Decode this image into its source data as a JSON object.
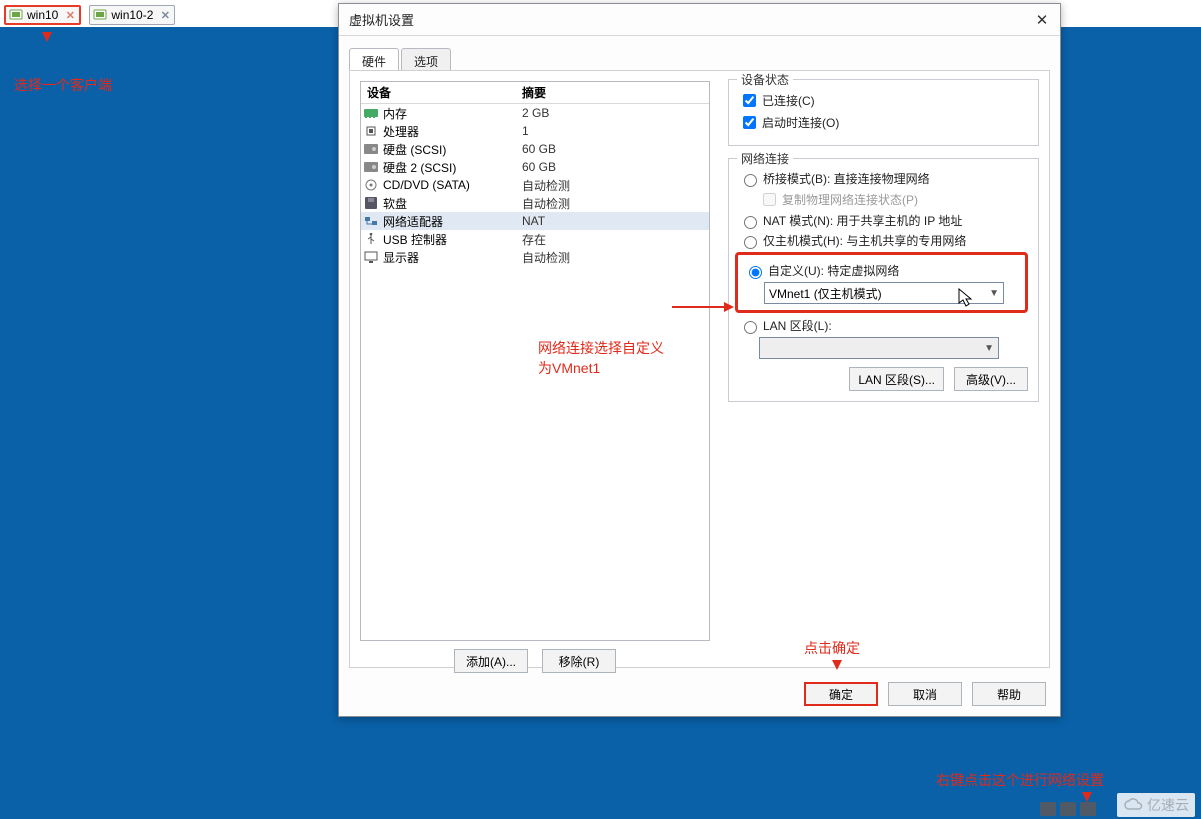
{
  "tabs": [
    {
      "label": "win10",
      "active": true
    },
    {
      "label": "win10-2",
      "active": false
    }
  ],
  "annotations": {
    "select_client": "选择一个客户端",
    "net_custom": "网络连接选择自定义\n为VMnet1",
    "click_ok": "点击确定",
    "right_click_net": "右键点击这个进行网络设置"
  },
  "dialog": {
    "title": "虚拟机设置",
    "tabs": {
      "hardware": "硬件",
      "options": "选项"
    },
    "hw_header": {
      "device": "设备",
      "summary": "摘要"
    },
    "hw": [
      {
        "name": "内存",
        "summary": "2 GB",
        "icon": "memory"
      },
      {
        "name": "处理器",
        "summary": "1",
        "icon": "cpu"
      },
      {
        "name": "硬盘 (SCSI)",
        "summary": "60 GB",
        "icon": "disk"
      },
      {
        "name": "硬盘 2 (SCSI)",
        "summary": "60 GB",
        "icon": "disk"
      },
      {
        "name": "CD/DVD (SATA)",
        "summary": "自动检测",
        "icon": "cd"
      },
      {
        "name": "软盘",
        "summary": "自动检测",
        "icon": "floppy"
      },
      {
        "name": "网络适配器",
        "summary": "NAT",
        "icon": "net",
        "selected": true
      },
      {
        "name": "USB 控制器",
        "summary": "存在",
        "icon": "usb"
      },
      {
        "name": "显示器",
        "summary": "自动检测",
        "icon": "display"
      }
    ],
    "add_btn": "添加(A)...",
    "remove_btn": "移除(R)",
    "device_state": {
      "title": "设备状态",
      "connected": "已连接(C)",
      "connect_at_start": "启动时连接(O)"
    },
    "net": {
      "title": "网络连接",
      "bridged": "桥接模式(B): 直接连接物理网络",
      "replicate": "复制物理网络连接状态(P)",
      "nat": "NAT 模式(N): 用于共享主机的 IP 地址",
      "hostonly": "仅主机模式(H): 与主机共享的专用网络",
      "custom": "自定义(U): 特定虚拟网络",
      "custom_value": "VMnet1 (仅主机模式)",
      "lan": "LAN 区段(L):",
      "lan_seg_btn": "LAN 区段(S)...",
      "advanced_btn": "高级(V)..."
    },
    "footer": {
      "ok": "确定",
      "cancel": "取消",
      "help": "帮助"
    }
  },
  "watermark": "亿速云"
}
